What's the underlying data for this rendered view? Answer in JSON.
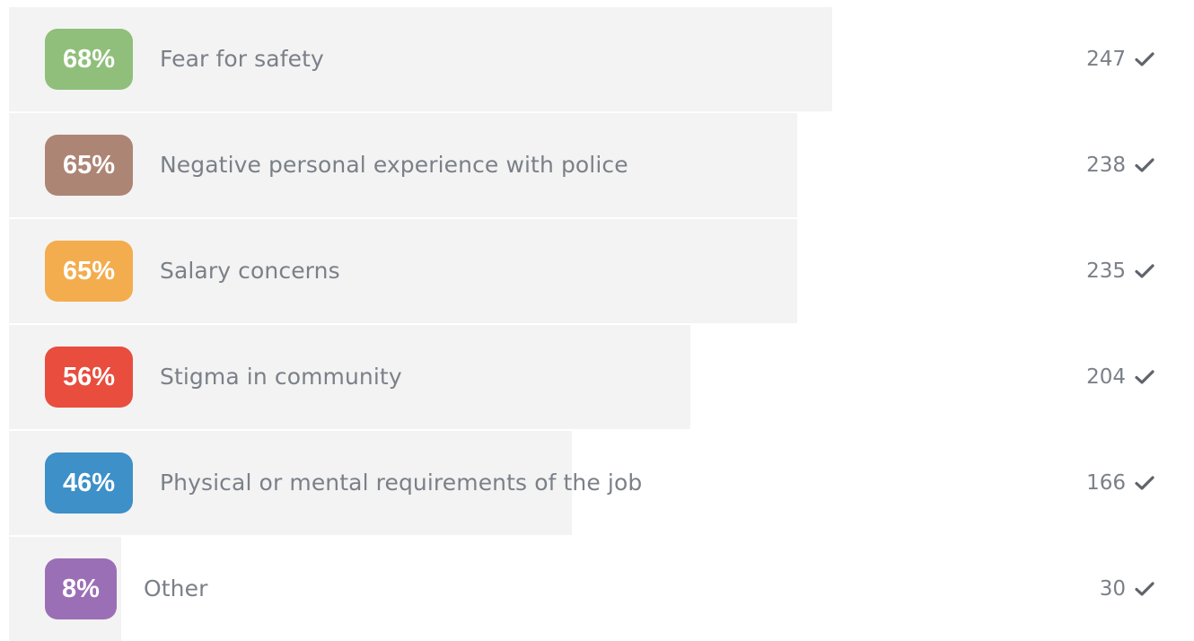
{
  "results": [
    {
      "percent_label": "68%",
      "fraction": 0.68,
      "label": "Fear for safety",
      "count": "247",
      "color": "#8fbf7a"
    },
    {
      "percent_label": "65%",
      "fraction": 0.65,
      "label": "Negative personal experience with police",
      "count": "238",
      "color": "#ad8575"
    },
    {
      "percent_label": "65%",
      "fraction": 0.65,
      "label": "Salary concerns",
      "count": "235",
      "color": "#f3ad4e"
    },
    {
      "percent_label": "56%",
      "fraction": 0.56,
      "label": "Stigma in community",
      "count": "204",
      "color": "#e84d3d"
    },
    {
      "percent_label": "46%",
      "fraction": 0.46,
      "label": "Physical or mental requirements of the job",
      "count": "166",
      "color": "#3d90c8"
    },
    {
      "percent_label": "8%",
      "fraction": 0.08,
      "label": "Other",
      "count": "30",
      "color": "#9b6fb5"
    }
  ],
  "icons": {
    "count": "check-icon"
  }
}
